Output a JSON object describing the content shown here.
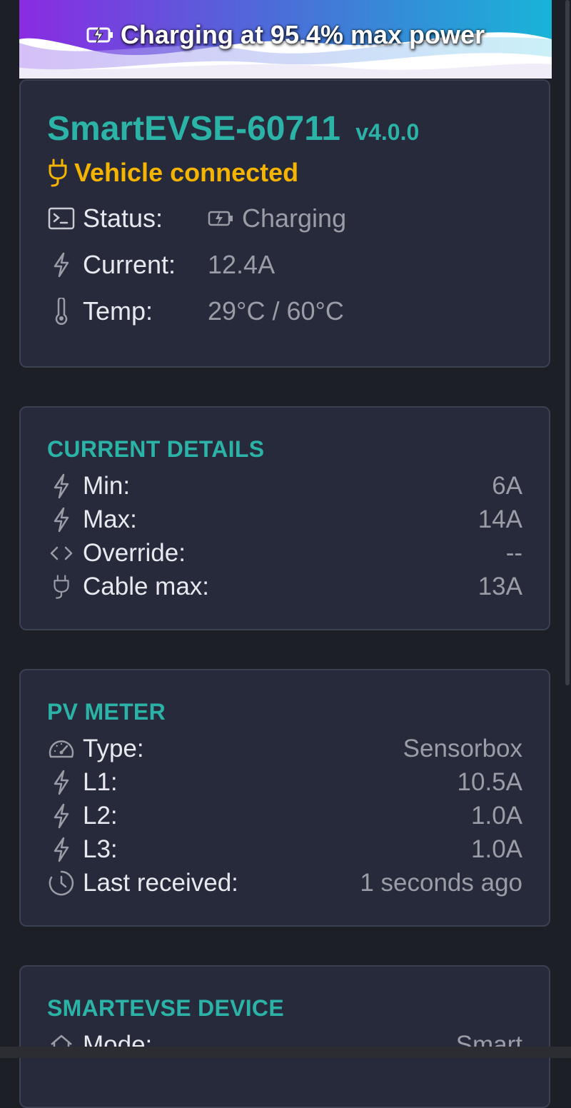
{
  "banner": {
    "text": "Charging at 95.4% max power"
  },
  "device": {
    "name": "SmartEVSE-60711",
    "version": "v4.0.0",
    "vehicle_status": "Vehicle connected",
    "rows": [
      {
        "label": "Status:",
        "value": "Charging",
        "icon": "terminal-icon"
      },
      {
        "label": "Current:",
        "value": "12.4A",
        "icon": "bolt-icon"
      },
      {
        "label": "Temp:",
        "value": "29°C / 60°C",
        "icon": "thermometer-icon"
      }
    ]
  },
  "current_details": {
    "title": "CURRENT DETAILS",
    "rows": [
      {
        "label": "Min:",
        "value": "6A",
        "icon": "bolt-icon"
      },
      {
        "label": "Max:",
        "value": "14A",
        "icon": "bolt-icon"
      },
      {
        "label": "Override:",
        "value": "--",
        "icon": "code-icon"
      },
      {
        "label": "Cable max:",
        "value": "13A",
        "icon": "plug-icon"
      }
    ]
  },
  "pv_meter": {
    "title": "PV METER",
    "rows": [
      {
        "label": "Type:",
        "value": "Sensorbox",
        "icon": "speedometer-icon"
      },
      {
        "label": "L1:",
        "value": "10.5A",
        "icon": "bolt-icon"
      },
      {
        "label": "L2:",
        "value": "1.0A",
        "icon": "bolt-icon"
      },
      {
        "label": "L3:",
        "value": "1.0A",
        "icon": "bolt-icon"
      },
      {
        "label": "Last received:",
        "value": "1 seconds ago",
        "icon": "clock-icon"
      }
    ]
  },
  "smartevse_device": {
    "title": "SMARTEVSE DEVICE",
    "rows": [
      {
        "label": "Mode:",
        "value": "Smart",
        "icon": "home-icon"
      }
    ]
  },
  "colors": {
    "accent": "#2bb3a8",
    "warning": "#f4b400",
    "card": "#262a3b",
    "background": "#1c1f26"
  }
}
